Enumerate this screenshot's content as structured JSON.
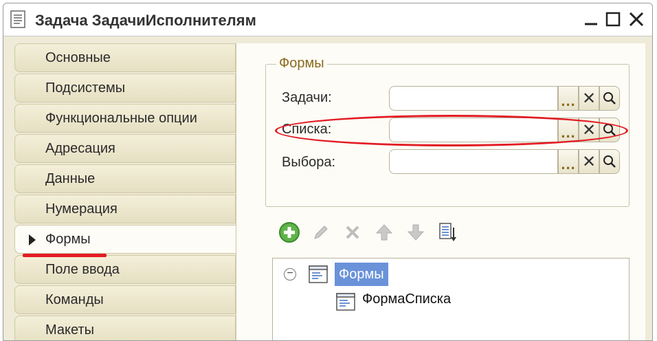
{
  "window": {
    "title": "Задача ЗадачиИсполнителям"
  },
  "sidebar": {
    "items": [
      {
        "label": "Основные"
      },
      {
        "label": "Подсистемы"
      },
      {
        "label": "Функциональные опции"
      },
      {
        "label": "Адресация"
      },
      {
        "label": "Данные"
      },
      {
        "label": "Нумерация"
      },
      {
        "label": "Формы",
        "active": true
      },
      {
        "label": "Поле ввода"
      },
      {
        "label": "Команды"
      },
      {
        "label": "Макеты"
      }
    ]
  },
  "forms_group": {
    "legend": "Формы",
    "fields": [
      {
        "label": "Задачи:",
        "value": ""
      },
      {
        "label": "Списка:",
        "value": ""
      },
      {
        "label": "Выбора:",
        "value": ""
      }
    ],
    "select_button": "...",
    "clear_button": "✕"
  },
  "toolbar": {
    "icons": [
      "add-icon",
      "edit-icon",
      "delete-icon",
      "move-up-icon",
      "move-down-icon",
      "sort-list-icon"
    ]
  },
  "tree": {
    "root_label": "Формы",
    "child_label": "ФормаСписка",
    "toggle": "−"
  },
  "colors": {
    "accent_red": "#e21b23",
    "selection_blue": "#6a92d9",
    "legend_brown": "#8b6a1c",
    "panel_bg": "#efebd8"
  }
}
